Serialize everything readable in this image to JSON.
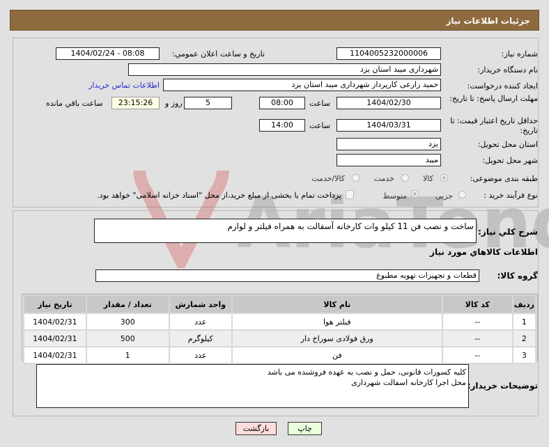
{
  "header": {
    "title": "جزئیات اطلاعات نیاز"
  },
  "form": {
    "need_number_label": "شماره نیاز:",
    "need_number": "1104005232000006",
    "announce_label": "تاریخ و ساعت اعلان عمومي:",
    "announce_value": "1404/02/24 - 08:08",
    "buyer_org_label": "نام دستگاه خریدار:",
    "buyer_org": "شهرداری میبد استان یزد",
    "creator_label": "ایجاد کننده درخواست:",
    "creator": "حمید زارعی کارپرداز شهرداری میبد استان یزد",
    "contact_link": "اطلاعات تماس خریدار",
    "reply_deadline_label": "مهلت ارسال پاسخ: تا تاریخ:",
    "reply_date": "1404/02/30",
    "time_label": "ساعت",
    "reply_time": "08:00",
    "days": "5",
    "days_label": "روز و",
    "remaining_time": "23:15:26",
    "remaining_label": "ساعت باقي مانده",
    "price_validity_label": "حداقل تاریخ اعتبار قیمت: تا تاریخ:",
    "price_date": "1404/03/31",
    "price_time": "14:00",
    "province_label": "استان محل تحویل:",
    "province": "یزد",
    "city_label": "شهر محل تحویل:",
    "city": "میبد",
    "category_label": "طبقه بندی موضوعی:",
    "category_options": [
      "کالا",
      "خدمت",
      "کالا/خدمت"
    ],
    "category_selected": "کالا",
    "process_label": "نوع فرآیند خرید :",
    "process_options": [
      "جزیی",
      "متوسط"
    ],
    "process_selected": "متوسط",
    "payment_note": "پرداخت تمام یا بخشی از مبلغ خرید،از محل \"اسناد خزانه اسلامی\" خواهد بود."
  },
  "details": {
    "summary_label": "شرح کلي نیاز:",
    "summary": "ساخت و نصب فن 11 کیلو وات کارخانه آسفالت به همراه  فیلتر و لوازم",
    "goods_heading": "اطلاعات کالاهاي مورد نیاز",
    "group_label": "گروه کالا:",
    "group": "قطعات و تجهیزات تهویه مطبوع",
    "table": {
      "headers": [
        "ردیف",
        "کد کالا",
        "نام کالا",
        "واحد شمارش",
        "تعداد / مقدار",
        "تاریخ نیاز"
      ],
      "rows": [
        [
          "1",
          "--",
          "فیلتر هوا",
          "عدد",
          "300",
          "1404/02/31"
        ],
        [
          "2",
          "--",
          "ورق فولادی سوراخ دار",
          "کیلوگرم",
          "500",
          "1404/02/31"
        ],
        [
          "3",
          "--",
          "فن",
          "عدد",
          "1",
          "1404/02/31"
        ]
      ]
    },
    "buyer_notes_label": "توضیحات خریدار:",
    "buyer_notes_line1": "کلیه کسورات قانونی، حمل و نصب به عهده فروشنده می باشد",
    "buyer_notes_line2": "محل اجرا کارخانه اسفالت شهرداری"
  },
  "buttons": {
    "print": "چاپ",
    "back": "بازگشت"
  },
  "watermark": "AriaTender.net"
}
